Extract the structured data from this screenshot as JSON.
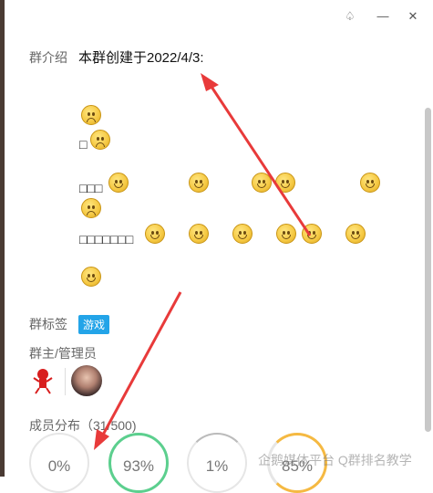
{
  "window": {
    "buttons": [
      {
        "name": "skin-icon",
        "glyph": "♤"
      },
      {
        "name": "minimize-icon",
        "glyph": "—"
      },
      {
        "name": "close-icon",
        "glyph": "✕"
      }
    ]
  },
  "intro": {
    "label": "群介绍",
    "title": "本群创建于2022/4/3:",
    "row2_text": "□",
    "row3_text": "□□□",
    "row5_text": "□□□□□□□"
  },
  "tags": {
    "label": "群标签",
    "items": [
      "游戏"
    ],
    "color": "#23a4e8"
  },
  "admins": {
    "label": "群主/管理员"
  },
  "members": {
    "label": "成员分布（3",
    "count_suffix": "1/500)",
    "rings": [
      {
        "value": "0%",
        "color": "#e6e6e6"
      },
      {
        "value": "93%",
        "color": "#5ccf8e"
      },
      {
        "value": "1%",
        "color": "#e6e6e6"
      },
      {
        "value": "85%",
        "color": "#f5b942"
      }
    ]
  },
  "watermark": "企鹅媒体平台 Q群排名教学"
}
